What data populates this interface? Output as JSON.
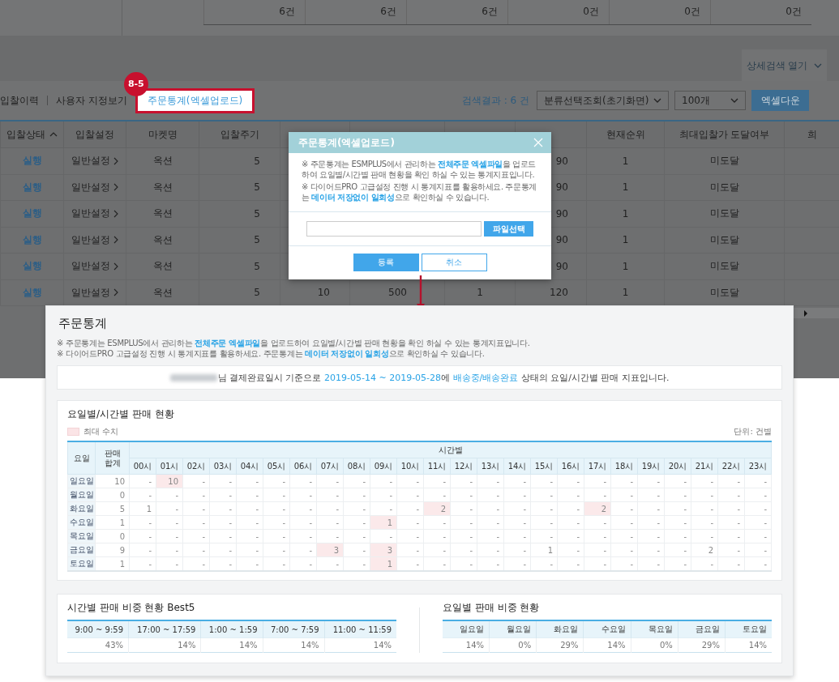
{
  "background_page": {
    "summary_cells": [
      "6건",
      "6건",
      "6건",
      "0건",
      "0건",
      "0건"
    ],
    "detail_search_toggle": "상세검색 열기",
    "view_links": [
      {
        "label": "입찰이력",
        "highlighted": false
      },
      {
        "label": "사용자 지정보기",
        "highlighted": false
      },
      {
        "label": "주문통계(엑셀업로드)",
        "highlighted": true
      }
    ],
    "step_badge": "8-5",
    "result_count": "검색결과 : 6 건",
    "category_select": "분류선택조회(초기화면)",
    "page_size_select": "100개",
    "excel_button": "엑셀다운",
    "table": {
      "columns": {
        "status": {
          "label": "입찰상태",
          "sorted_ascending": true
        },
        "setting": {
          "label": "입찰설정",
          "sorted_ascending": false
        },
        "market": {
          "label": "마켓명",
          "sorted_ascending": false
        },
        "cycle": {
          "label": "입찰주기",
          "sorted_ascending": false
        },
        "rank": {
          "label": "현재순위",
          "sorted_ascending": false
        },
        "reached": {
          "label": "최대입찰가 도달여부",
          "sorted_ascending": false
        },
        "extra": {
          "label": "희",
          "sorted_ascending": false
        }
      },
      "rows": [
        {
          "status": "실행",
          "setting": "일반설정",
          "market": "옥션",
          "cycle": "5",
          "bid": "90",
          "rank": "1",
          "reached": "미도달"
        },
        {
          "status": "실행",
          "setting": "일반설정",
          "market": "옥션",
          "cycle": "5",
          "bid": "90",
          "rank": "1",
          "reached": "미도달"
        },
        {
          "status": "실행",
          "setting": "일반설정",
          "market": "옥션",
          "cycle": "5",
          "bid": "90",
          "rank": "1",
          "reached": "미도달"
        },
        {
          "status": "실행",
          "setting": "일반설정",
          "market": "옥션",
          "cycle": "5",
          "bid": "90",
          "rank": "1",
          "reached": "미도달"
        },
        {
          "status": "실행",
          "setting": "일반설정",
          "market": "옥션",
          "cycle": "5",
          "bid": "90",
          "rank": "1",
          "reached": "미도달"
        },
        {
          "status": "실행",
          "setting": "일반설정",
          "market": "옥션",
          "cycle": "5",
          "adjust": "10",
          "max_bid": "500",
          "min_rank": "1",
          "bid": "120",
          "rank": "1",
          "reached": "미도달"
        }
      ]
    }
  },
  "dialog": {
    "title": "주문통계(엑셀업로드)",
    "notes": [
      [
        {
          "text": "※ 주문통계는 ESMPLUS에서 관리하는 ",
          "highlight": false
        },
        {
          "text": "전체주문 엑셀파일",
          "highlight": true
        },
        {
          "text": "을 업로드하여 요일별/시간별 판매 현황을 확인 하실 수 있는 통계지표입니다.",
          "highlight": false
        }
      ],
      [
        {
          "text": "※ 다이어드PRO 고급설정 진행 시 통계지표를 활용하세요. 주문통계는 ",
          "highlight": false
        },
        {
          "text": "데이터 저장없이 일회성",
          "highlight": true
        },
        {
          "text": "으로 확인하실 수 있습니다.",
          "highlight": false
        }
      ]
    ],
    "file_button": "파일선택",
    "buttons": [
      {
        "label": "등록",
        "primary": true
      },
      {
        "label": "취소",
        "primary": false
      }
    ]
  },
  "stats_panel": {
    "title": "주문통계",
    "notes": [
      [
        {
          "text": "※ 주문통계는 ESMPLUS에서 관리하는 ",
          "highlight": false
        },
        {
          "text": "전체주문 엑셀파일",
          "highlight": true
        },
        {
          "text": "을 업로드하여 요일별/시간별 판매 현황을 확인 하실 수 있는 통계지표입니다.",
          "highlight": false
        }
      ],
      [
        {
          "text": "※ 다이어드PRO 고급설정 진행 시 통계지표를 활용하세요. 주문통계는 ",
          "highlight": false
        },
        {
          "text": "데이터 저장없이 일회성",
          "highlight": true
        },
        {
          "text": "으로 확인하실 수 있습니다.",
          "highlight": false
        }
      ]
    ],
    "summary": {
      "name_redacted": true,
      "segments": [
        {
          "text": "님 결제완료일시 기준으로 ",
          "highlight": false
        },
        {
          "text": "2019-05-14 ~ 2019-05-28",
          "highlight": true
        },
        {
          "text": "에 ",
          "highlight": false
        },
        {
          "text": "배송중/배송완료",
          "highlight": true
        },
        {
          "text": " 상태의 요일/시간별 판매 지표입니다.",
          "highlight": false
        }
      ]
    },
    "heatmap": {
      "title": "요일별/시간별 판매 현황",
      "legend": "최대 수치",
      "unit": "단위: 건별",
      "day_header": "요일",
      "total_header": "판매 합계",
      "hours_header": "시간별",
      "hours": [
        "00시",
        "01시",
        "02시",
        "03시",
        "04시",
        "05시",
        "06시",
        "07시",
        "08시",
        "09시",
        "10시",
        "11시",
        "12시",
        "13시",
        "14시",
        "15시",
        "16시",
        "17시",
        "18시",
        "19시",
        "20시",
        "21시",
        "22시",
        "23시"
      ],
      "rows": [
        {
          "day": "일요일",
          "total": "10",
          "cells": [
            {
              "value": "-",
              "max": false
            },
            {
              "value": "10",
              "max": true
            },
            {
              "value": "-",
              "max": false
            },
            {
              "value": "-",
              "max": false
            },
            {
              "value": "-",
              "max": false
            },
            {
              "value": "-",
              "max": false
            },
            {
              "value": "-",
              "max": false
            },
            {
              "value": "-",
              "max": false
            },
            {
              "value": "-",
              "max": false
            },
            {
              "value": "-",
              "max": false
            },
            {
              "value": "-",
              "max": false
            },
            {
              "value": "-",
              "max": false
            },
            {
              "value": "-",
              "max": false
            },
            {
              "value": "-",
              "max": false
            },
            {
              "value": "-",
              "max": false
            },
            {
              "value": "-",
              "max": false
            },
            {
              "value": "-",
              "max": false
            },
            {
              "value": "-",
              "max": false
            },
            {
              "value": "-",
              "max": false
            },
            {
              "value": "-",
              "max": false
            },
            {
              "value": "-",
              "max": false
            },
            {
              "value": "-",
              "max": false
            },
            {
              "value": "-",
              "max": false
            },
            {
              "value": "-",
              "max": false
            }
          ]
        },
        {
          "day": "월요일",
          "total": "0",
          "cells": [
            {
              "value": "-",
              "max": false
            },
            {
              "value": "-",
              "max": false
            },
            {
              "value": "-",
              "max": false
            },
            {
              "value": "-",
              "max": false
            },
            {
              "value": "-",
              "max": false
            },
            {
              "value": "-",
              "max": false
            },
            {
              "value": "-",
              "max": false
            },
            {
              "value": "-",
              "max": false
            },
            {
              "value": "-",
              "max": false
            },
            {
              "value": "-",
              "max": false
            },
            {
              "value": "-",
              "max": false
            },
            {
              "value": "-",
              "max": false
            },
            {
              "value": "-",
              "max": false
            },
            {
              "value": "-",
              "max": false
            },
            {
              "value": "-",
              "max": false
            },
            {
              "value": "-",
              "max": false
            },
            {
              "value": "-",
              "max": false
            },
            {
              "value": "-",
              "max": false
            },
            {
              "value": "-",
              "max": false
            },
            {
              "value": "-",
              "max": false
            },
            {
              "value": "-",
              "max": false
            },
            {
              "value": "-",
              "max": false
            },
            {
              "value": "-",
              "max": false
            },
            {
              "value": "-",
              "max": false
            }
          ]
        },
        {
          "day": "화요일",
          "total": "5",
          "cells": [
            {
              "value": "1",
              "max": false
            },
            {
              "value": "-",
              "max": false
            },
            {
              "value": "-",
              "max": false
            },
            {
              "value": "-",
              "max": false
            },
            {
              "value": "-",
              "max": false
            },
            {
              "value": "-",
              "max": false
            },
            {
              "value": "-",
              "max": false
            },
            {
              "value": "-",
              "max": false
            },
            {
              "value": "-",
              "max": false
            },
            {
              "value": "-",
              "max": false
            },
            {
              "value": "-",
              "max": false
            },
            {
              "value": "2",
              "max": true
            },
            {
              "value": "-",
              "max": false
            },
            {
              "value": "-",
              "max": false
            },
            {
              "value": "-",
              "max": false
            },
            {
              "value": "-",
              "max": false
            },
            {
              "value": "-",
              "max": false
            },
            {
              "value": "2",
              "max": true
            },
            {
              "value": "-",
              "max": false
            },
            {
              "value": "-",
              "max": false
            },
            {
              "value": "-",
              "max": false
            },
            {
              "value": "-",
              "max": false
            },
            {
              "value": "-",
              "max": false
            },
            {
              "value": "-",
              "max": false
            }
          ]
        },
        {
          "day": "수요일",
          "total": "1",
          "cells": [
            {
              "value": "-",
              "max": false
            },
            {
              "value": "-",
              "max": false
            },
            {
              "value": "-",
              "max": false
            },
            {
              "value": "-",
              "max": false
            },
            {
              "value": "-",
              "max": false
            },
            {
              "value": "-",
              "max": false
            },
            {
              "value": "-",
              "max": false
            },
            {
              "value": "-",
              "max": false
            },
            {
              "value": "-",
              "max": false
            },
            {
              "value": "1",
              "max": true
            },
            {
              "value": "-",
              "max": false
            },
            {
              "value": "-",
              "max": false
            },
            {
              "value": "-",
              "max": false
            },
            {
              "value": "-",
              "max": false
            },
            {
              "value": "-",
              "max": false
            },
            {
              "value": "-",
              "max": false
            },
            {
              "value": "-",
              "max": false
            },
            {
              "value": "-",
              "max": false
            },
            {
              "value": "-",
              "max": false
            },
            {
              "value": "-",
              "max": false
            },
            {
              "value": "-",
              "max": false
            },
            {
              "value": "-",
              "max": false
            },
            {
              "value": "-",
              "max": false
            },
            {
              "value": "-",
              "max": false
            }
          ]
        },
        {
          "day": "목요일",
          "total": "0",
          "cells": [
            {
              "value": "-",
              "max": false
            },
            {
              "value": "-",
              "max": false
            },
            {
              "value": "-",
              "max": false
            },
            {
              "value": "-",
              "max": false
            },
            {
              "value": "-",
              "max": false
            },
            {
              "value": "-",
              "max": false
            },
            {
              "value": "-",
              "max": false
            },
            {
              "value": "-",
              "max": false
            },
            {
              "value": "-",
              "max": false
            },
            {
              "value": "-",
              "max": false
            },
            {
              "value": "-",
              "max": false
            },
            {
              "value": "-",
              "max": false
            },
            {
              "value": "-",
              "max": false
            },
            {
              "value": "-",
              "max": false
            },
            {
              "value": "-",
              "max": false
            },
            {
              "value": "-",
              "max": false
            },
            {
              "value": "-",
              "max": false
            },
            {
              "value": "-",
              "max": false
            },
            {
              "value": "-",
              "max": false
            },
            {
              "value": "-",
              "max": false
            },
            {
              "value": "-",
              "max": false
            },
            {
              "value": "-",
              "max": false
            },
            {
              "value": "-",
              "max": false
            },
            {
              "value": "-",
              "max": false
            }
          ]
        },
        {
          "day": "금요일",
          "total": "9",
          "cells": [
            {
              "value": "-",
              "max": false
            },
            {
              "value": "-",
              "max": false
            },
            {
              "value": "-",
              "max": false
            },
            {
              "value": "-",
              "max": false
            },
            {
              "value": "-",
              "max": false
            },
            {
              "value": "-",
              "max": false
            },
            {
              "value": "-",
              "max": false
            },
            {
              "value": "3",
              "max": true
            },
            {
              "value": "-",
              "max": false
            },
            {
              "value": "3",
              "max": true
            },
            {
              "value": "-",
              "max": false
            },
            {
              "value": "-",
              "max": false
            },
            {
              "value": "-",
              "max": false
            },
            {
              "value": "-",
              "max": false
            },
            {
              "value": "-",
              "max": false
            },
            {
              "value": "1",
              "max": false
            },
            {
              "value": "-",
              "max": false
            },
            {
              "value": "-",
              "max": false
            },
            {
              "value": "-",
              "max": false
            },
            {
              "value": "-",
              "max": false
            },
            {
              "value": "-",
              "max": false
            },
            {
              "value": "2",
              "max": false
            },
            {
              "value": "-",
              "max": false
            },
            {
              "value": "-",
              "max": false
            }
          ]
        },
        {
          "day": "토요일",
          "total": "1",
          "cells": [
            {
              "value": "-",
              "max": false
            },
            {
              "value": "-",
              "max": false
            },
            {
              "value": "-",
              "max": false
            },
            {
              "value": "-",
              "max": false
            },
            {
              "value": "-",
              "max": false
            },
            {
              "value": "-",
              "max": false
            },
            {
              "value": "-",
              "max": false
            },
            {
              "value": "-",
              "max": false
            },
            {
              "value": "-",
              "max": false
            },
            {
              "value": "1",
              "max": true
            },
            {
              "value": "-",
              "max": false
            },
            {
              "value": "-",
              "max": false
            },
            {
              "value": "-",
              "max": false
            },
            {
              "value": "-",
              "max": false
            },
            {
              "value": "-",
              "max": false
            },
            {
              "value": "-",
              "max": false
            },
            {
              "value": "-",
              "max": false
            },
            {
              "value": "-",
              "max": false
            },
            {
              "value": "-",
              "max": false
            },
            {
              "value": "-",
              "max": false
            },
            {
              "value": "-",
              "max": false
            },
            {
              "value": "-",
              "max": false
            },
            {
              "value": "-",
              "max": false
            },
            {
              "value": "-",
              "max": false
            }
          ]
        }
      ]
    },
    "best5": {
      "title": "시간별 판매 비중 현황 Best5",
      "columns": [
        "9:00 ~ 9:59",
        "17:00 ~ 17:59",
        "1:00 ~ 1:59",
        "7:00 ~ 7:59",
        "11:00 ~ 11:59"
      ],
      "values": [
        "43%",
        "14%",
        "14%",
        "14%",
        "14%"
      ]
    },
    "weekday_share": {
      "title": "요일별 판매 비중 현황",
      "columns": [
        "일요일",
        "월요일",
        "화요일",
        "수요일",
        "목요일",
        "금요일",
        "토요일"
      ],
      "values": [
        "14%",
        "0%",
        "29%",
        "14%",
        "0%",
        "29%",
        "14%"
      ]
    }
  }
}
